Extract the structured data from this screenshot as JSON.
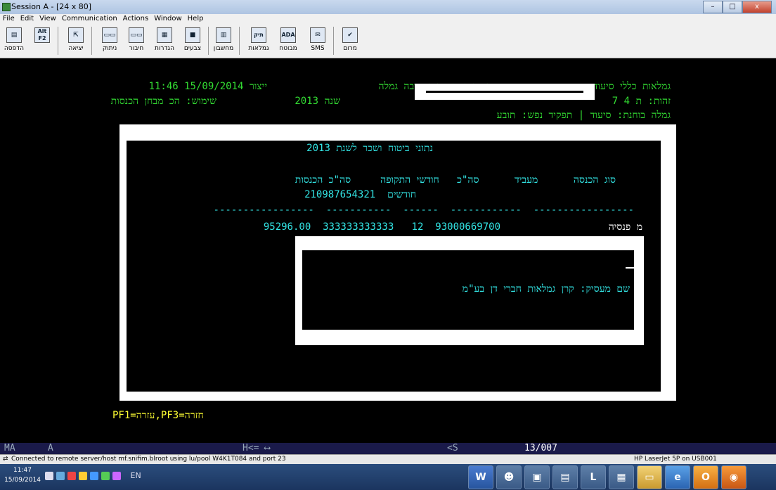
{
  "window": {
    "title": "Session A - [24 x 80]",
    "min_glyph": "–",
    "max_glyph": "□",
    "close_glyph": "x"
  },
  "menu": [
    "File",
    "Edit",
    "View",
    "Communication",
    "Actions",
    "Window",
    "Help"
  ],
  "toolbar": [
    {
      "icon": "printer-icon",
      "glyph": "▤",
      "label": "הדפסה"
    },
    {
      "icon": "alt-f2-icon",
      "glyph": "Alt F2",
      "label": ""
    },
    {
      "icon": "exit-icon",
      "glyph": "⇱",
      "label": "יציאה"
    },
    {
      "icon": "disconnect-icon",
      "glyph": "▭▭",
      "label": "ניתוק"
    },
    {
      "icon": "connect-icon",
      "glyph": "▭▭",
      "label": "חיבור"
    },
    {
      "icon": "settings-icon",
      "glyph": "▦",
      "label": "הגדרות"
    },
    {
      "icon": "colors-icon",
      "glyph": "■",
      "label": "צבעים"
    },
    {
      "icon": "calculator-icon",
      "glyph": "▥",
      "label": "מחשבון"
    },
    {
      "icon": "pension-file-icon",
      "glyph": "תיק",
      "label": "גמלאות"
    },
    {
      "icon": "ada-icon",
      "glyph": "ADA",
      "label": "מבוטח"
    },
    {
      "icon": "sms-icon",
      "glyph": "✉",
      "label": "SMS"
    },
    {
      "icon": "check-icon",
      "glyph": "✔",
      "label": "מרום"
    }
  ],
  "terminal": {
    "header_system": "גמלאות כללי סיעוד",
    "header_title": "הכנסות מדווחות וגובה גמלה",
    "header_created": "ייצור 15/09/2014 11:46",
    "id_label": "זהות: ת 4 7",
    "year": "שנה 2013",
    "usage": "שימוש: הכ מבחן הכנסות",
    "benefit_line": "גמלה בוחנת: סיעוד | תפקיד נפש: תובע",
    "panel_title": "נתוני ביטוח ושכר לשנת 2013",
    "columns_header": "סוג הכנסה      מעביד      סה\"כ   חודשי התקופה     סה\"כ הכנסות",
    "columns_sub": "חודשים  210987654321",
    "dashes": "-----------------  -----------  ------  ------------  -----------------",
    "row_type": "מ פנסיה",
    "row_values": "95296.00  333333333333   12  93000669700",
    "employer_detail": "שם מעסיק: קרן גמלאות חברי דן בע\"מ",
    "pf_keys": "PF1=עזרה,PF3=חזרה"
  },
  "status": {
    "mode": "MA",
    "session": "A",
    "keys": "H<= ⟷",
    "shift": "<S",
    "position": "13/007"
  },
  "connection": {
    "text": "Connected to remote server/host mf.snifim.blroot using lu/pool W4K1T084 and port 23",
    "printer": "HP LaserJet 5P on USB001"
  },
  "taskbar": {
    "time": "11:47",
    "date": "15/09/2014",
    "lang": "EN",
    "apps": [
      {
        "icon": "word-icon",
        "glyph": "W"
      },
      {
        "icon": "network-user-icon",
        "glyph": "☻"
      },
      {
        "icon": "terminal-app-icon",
        "glyph": "▣"
      },
      {
        "icon": "document-app-icon",
        "glyph": "▤"
      },
      {
        "icon": "lync-icon",
        "glyph": "L"
      },
      {
        "icon": "notes-app-icon",
        "glyph": "▦"
      },
      {
        "icon": "folder-icon",
        "glyph": "▭"
      },
      {
        "icon": "internet-explorer-icon",
        "glyph": "e"
      },
      {
        "icon": "outlook-icon",
        "glyph": "O"
      },
      {
        "icon": "firefox-icon",
        "glyph": "◉"
      }
    ]
  },
  "colors": {
    "terminal_green": "#33dd33",
    "terminal_yellow": "#ffff33",
    "terminal_cyan": "#33e6e6"
  }
}
